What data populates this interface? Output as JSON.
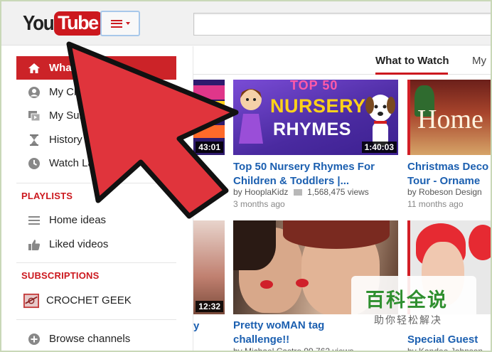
{
  "header": {
    "logo_you": "You",
    "logo_tube": "Tube",
    "search_placeholder": ""
  },
  "tabs": [
    {
      "label": "What to Watch"
    },
    {
      "label": "My"
    }
  ],
  "sidebar": {
    "items": [
      {
        "label": "What",
        "icon": "home-icon"
      },
      {
        "label": "My Cha",
        "icon": "person-icon"
      },
      {
        "label": "My Subsc",
        "icon": "subscriptions-icon"
      },
      {
        "label": "History",
        "icon": "hourglass-icon"
      },
      {
        "label": "Watch Later",
        "icon": "clock-icon"
      }
    ],
    "playlists_title": "PLAYLISTS",
    "playlists": [
      {
        "label": "Home ideas",
        "icon": "playlist-icon"
      },
      {
        "label": "Liked videos",
        "icon": "thumbs-up-icon"
      }
    ],
    "subscriptions_title": "SUBSCRIPTIONS",
    "subscriptions": [
      {
        "label": "CROCHET GEEK",
        "icon": "channel-thumbnail"
      }
    ],
    "browse_label": "Browse channels"
  },
  "videos": {
    "left_partial_top_duration": "43:01",
    "left_partial_bottom_duration": "12:32",
    "left_partial_bottom_title": "y",
    "v1": {
      "thumb_line1": "TOP 50",
      "thumb_line2": "NURSERY",
      "thumb_line3": "RHYMES",
      "duration": "1:40:03",
      "title_line1": "Top 50 Nursery Rhymes For",
      "title_line2": "Children & Toddlers |...",
      "channel": "by HooplaKidz",
      "views": "1,568,475 views",
      "age": "3 months ago"
    },
    "v2": {
      "thumb_text": "Home",
      "title_line1": "Christmas Deco",
      "title_line2": "Tour - Orname",
      "channel": "by Robeson Design",
      "age": "11 months ago"
    },
    "v3": {
      "title_line1": "Pretty woMAN tag",
      "title_line2": "challenge!!",
      "meta": "by Michael Castro  99,762 views"
    },
    "v4": {
      "title_line2": "Special Guest",
      "meta": "by Kandee  Johnson"
    }
  },
  "watermark": {
    "brand": "百科全说",
    "sub": "助你轻松解决"
  },
  "colors": {
    "brand_red": "#cc181e",
    "link_blue": "#1b5fb0",
    "arrow_red": "#e0343c"
  }
}
